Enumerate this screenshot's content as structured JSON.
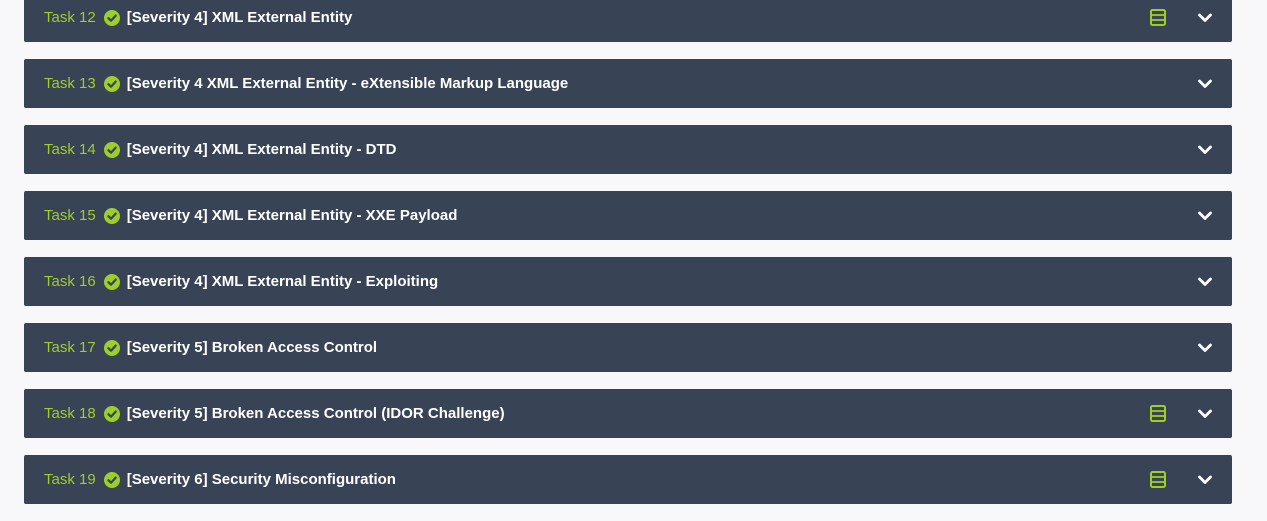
{
  "colors": {
    "page_bg": "#f8f8fb",
    "row_bg": "#384356",
    "accent_green": "#9fcd2b",
    "title_text": "#ffffff"
  },
  "tasks": [
    {
      "num": "Task 12",
      "title": "[Severity 4] XML External Entity",
      "completed": true,
      "has_machine": true
    },
    {
      "num": "Task 13",
      "title": "[Severity 4 XML External Entity - eXtensible Markup Language",
      "completed": true,
      "has_machine": false
    },
    {
      "num": "Task 14",
      "title": "[Severity 4] XML External Entity - DTD",
      "completed": true,
      "has_machine": false
    },
    {
      "num": "Task 15",
      "title": "[Severity 4] XML External Entity - XXE Payload",
      "completed": true,
      "has_machine": false
    },
    {
      "num": "Task 16",
      "title": "[Severity 4] XML External Entity - Exploiting",
      "completed": true,
      "has_machine": false
    },
    {
      "num": "Task 17",
      "title": "[Severity 5] Broken Access Control",
      "completed": true,
      "has_machine": false
    },
    {
      "num": "Task 18",
      "title": "[Severity 5] Broken Access Control (IDOR Challenge)",
      "completed": true,
      "has_machine": true
    },
    {
      "num": "Task 19",
      "title": "[Severity 6] Security Misconfiguration",
      "completed": true,
      "has_machine": true
    }
  ],
  "icons": {
    "status": "check-circle-icon",
    "machine": "server-icon",
    "expand": "chevron-down-icon"
  }
}
